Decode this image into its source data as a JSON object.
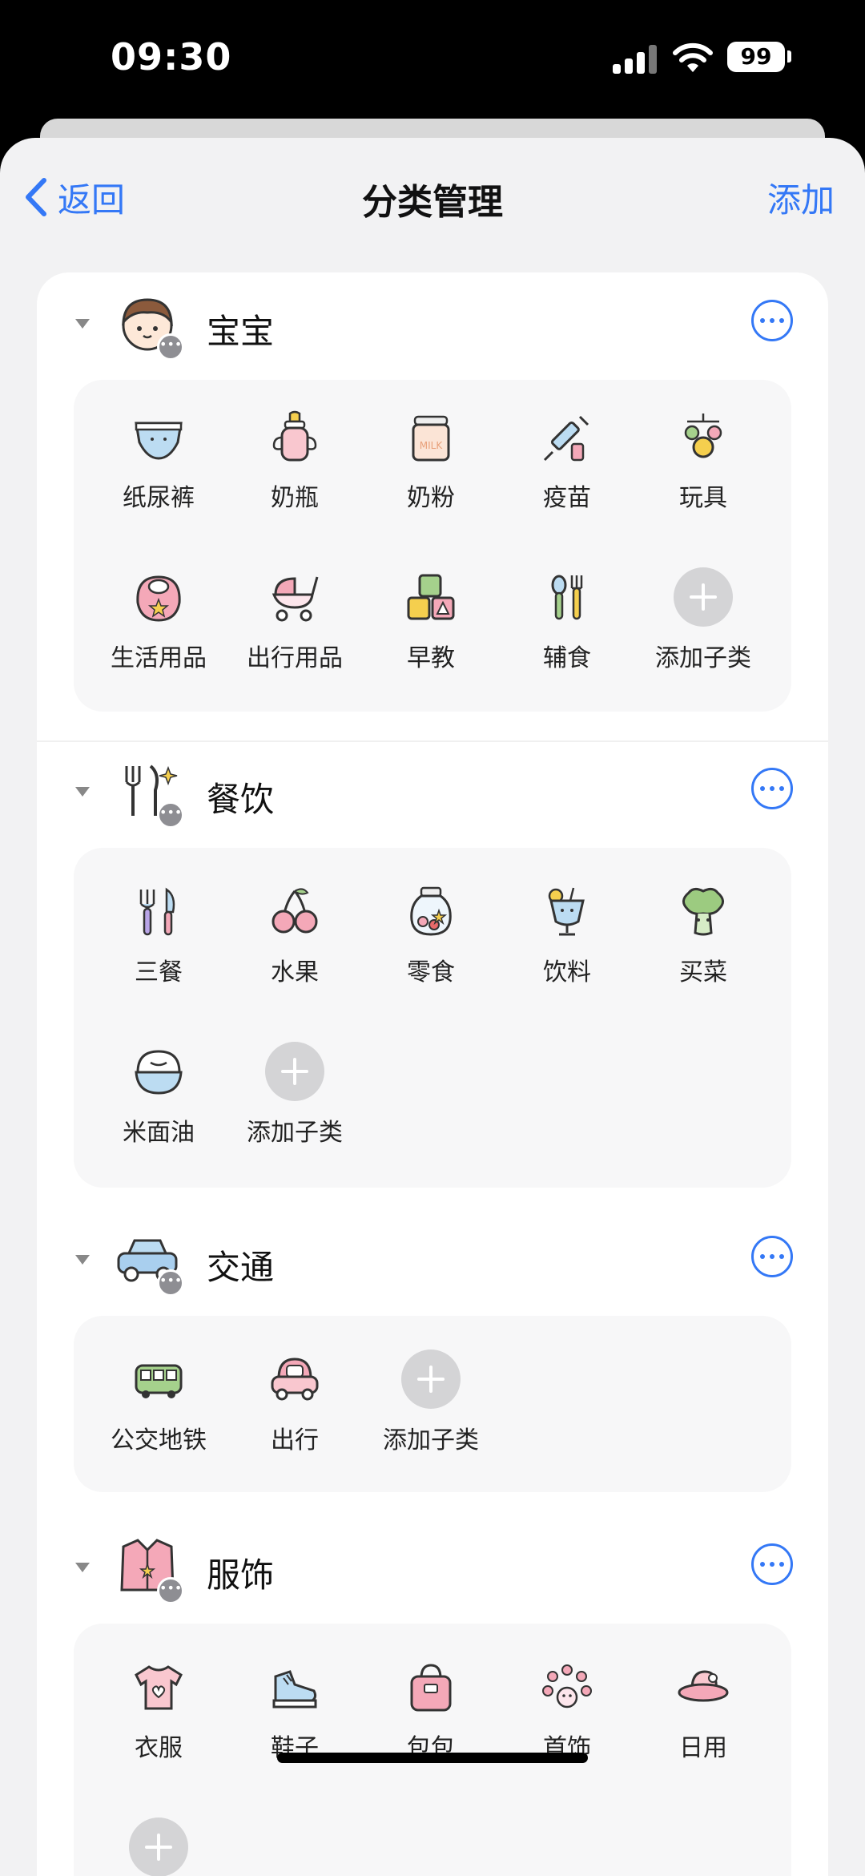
{
  "status": {
    "time": "09:30",
    "battery": "99"
  },
  "nav": {
    "back_label": "返回",
    "title": "分类管理",
    "add_label": "添加"
  },
  "categories": [
    {
      "name": "宝宝",
      "icon": "baby-face-icon",
      "subs": [
        {
          "label": "纸尿裤",
          "icon": "diaper-icon"
        },
        {
          "label": "奶瓶",
          "icon": "baby-bottle-icon"
        },
        {
          "label": "奶粉",
          "icon": "milk-powder-icon"
        },
        {
          "label": "疫苗",
          "icon": "syringe-icon"
        },
        {
          "label": "玩具",
          "icon": "toy-icon"
        },
        {
          "label": "生活用品",
          "icon": "bib-icon"
        },
        {
          "label": "出行用品",
          "icon": "stroller-icon"
        },
        {
          "label": "早教",
          "icon": "blocks-icon"
        },
        {
          "label": "辅食",
          "icon": "spoon-fork-icon"
        }
      ]
    },
    {
      "name": "餐饮",
      "icon": "cutlery-icon",
      "subs": [
        {
          "label": "三餐",
          "icon": "fork-knife-icon"
        },
        {
          "label": "水果",
          "icon": "cherry-icon"
        },
        {
          "label": "零食",
          "icon": "snack-jar-icon"
        },
        {
          "label": "饮料",
          "icon": "drink-icon"
        },
        {
          "label": "买菜",
          "icon": "broccoli-icon"
        },
        {
          "label": "米面油",
          "icon": "rice-bowl-icon"
        }
      ]
    },
    {
      "name": "交通",
      "icon": "car-icon",
      "subs": [
        {
          "label": "公交地铁",
          "icon": "bus-icon"
        },
        {
          "label": "出行",
          "icon": "small-car-icon"
        }
      ]
    },
    {
      "name": "服饰",
      "icon": "cardigan-icon",
      "subs": [
        {
          "label": "衣服",
          "icon": "tshirt-icon"
        },
        {
          "label": "鞋子",
          "icon": "sneaker-icon"
        },
        {
          "label": "包包",
          "icon": "bag-icon"
        },
        {
          "label": "首饰",
          "icon": "bracelet-icon"
        },
        {
          "label": "日用",
          "icon": "hat-icon"
        }
      ]
    }
  ],
  "add_sub_label": "添加子类",
  "colors": {
    "accent": "#3478f6",
    "pink": "#f4a8b8",
    "blue": "#a9cfee",
    "green": "#a5d18c",
    "yellow": "#f5cf4e"
  }
}
